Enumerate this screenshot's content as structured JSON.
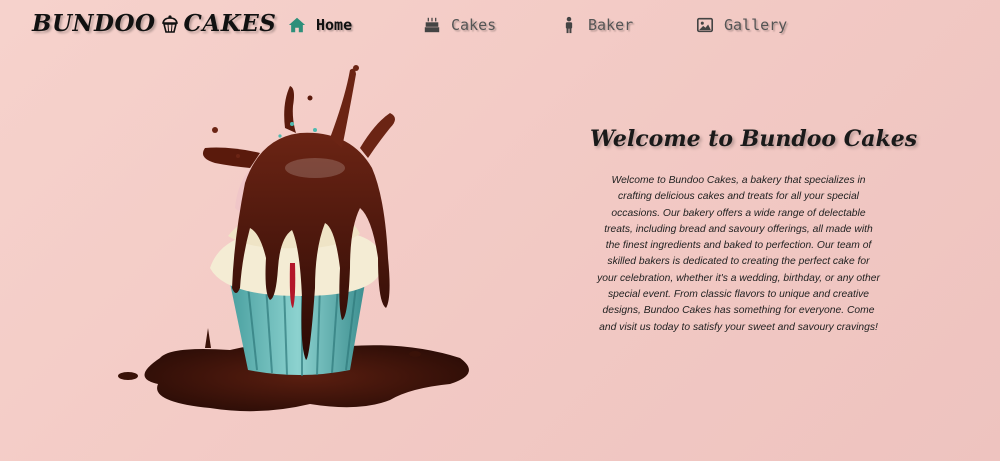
{
  "header": {
    "logo_left": "BUNDOO",
    "logo_right": "CAKES",
    "logo_icon": "cupcake-icon"
  },
  "nav": {
    "items": [
      {
        "label": "Home",
        "icon": "home-icon",
        "active": true
      },
      {
        "label": "Cakes",
        "icon": "birthday-cake-icon",
        "active": false
      },
      {
        "label": "Baker",
        "icon": "person-icon",
        "active": false
      },
      {
        "label": "Gallery",
        "icon": "image-icon",
        "active": false
      }
    ]
  },
  "colors": {
    "background": "#f4cdc7",
    "accent_home_icon": "#2e8f7a",
    "text": "#111111",
    "muted": "#555555"
  },
  "main": {
    "image_alt_icon": "cupcake-hero-image",
    "title": "Welcome to Bundoo Cakes",
    "body": "Welcome to Bundoo Cakes, a bakery that specializes in crafting delicious cakes and treats for all your special occasions. Our bakery offers a wide range of delectable treats, including bread and savoury offerings, all made with the finest ingredients and baked to perfection. Our team of skilled bakers is dedicated to creating the perfect cake for your celebration, whether it's a wedding, birthday, or any other special event. From classic flavors to unique and creative designs, Bundoo Cakes has something for everyone. Come and visit us today to satisfy your sweet and savoury cravings!"
  }
}
